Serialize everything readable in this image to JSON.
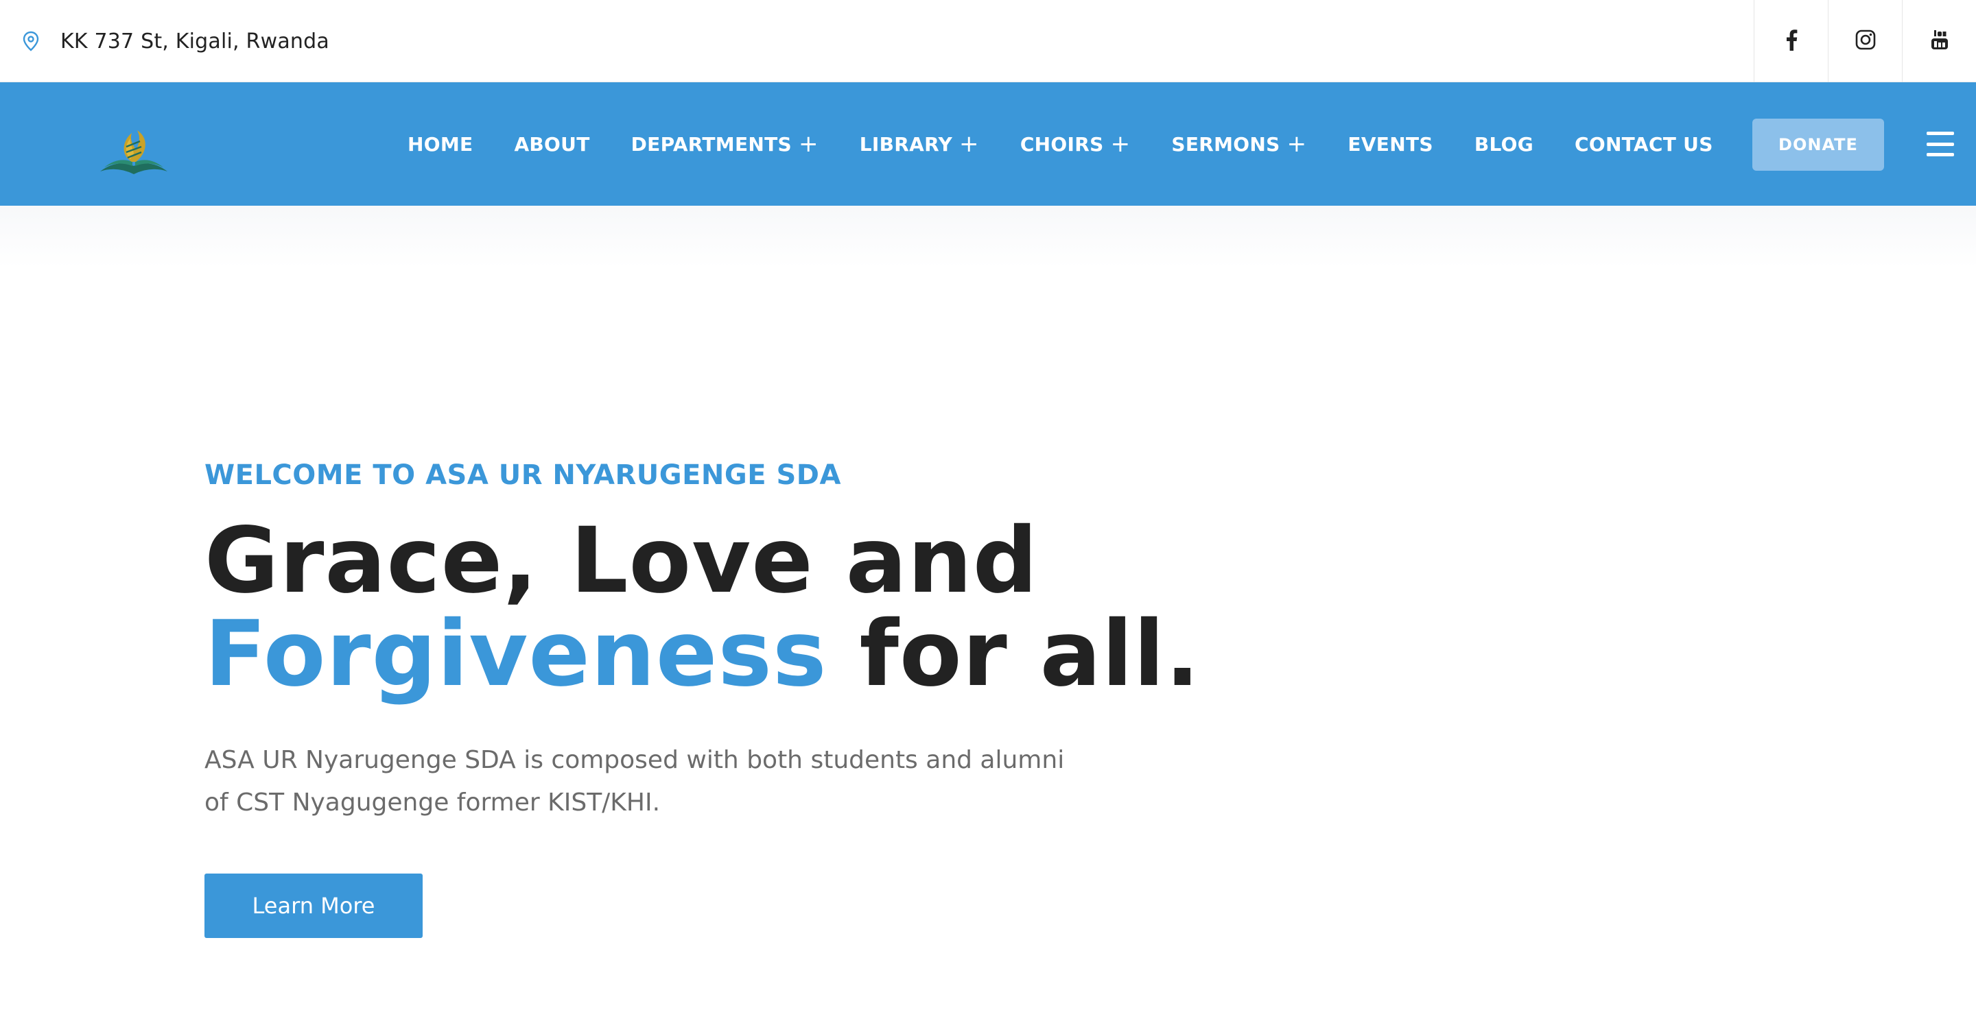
{
  "topbar": {
    "address": "KK 737 St, Kigali, Rwanda",
    "social": [
      "facebook-icon",
      "instagram-icon",
      "youtube-icon"
    ]
  },
  "nav": {
    "items": [
      {
        "label": "HOME",
        "has_submenu": false
      },
      {
        "label": "ABOUT",
        "has_submenu": false
      },
      {
        "label": "DEPARTMENTS",
        "has_submenu": true
      },
      {
        "label": "LIBRARY",
        "has_submenu": true
      },
      {
        "label": "CHOIRS",
        "has_submenu": true
      },
      {
        "label": "SERMONS",
        "has_submenu": true
      },
      {
        "label": "EVENTS",
        "has_submenu": false
      },
      {
        "label": "BLOG",
        "has_submenu": false
      },
      {
        "label": "CONTACT US",
        "has_submenu": false
      }
    ],
    "donate_label": "DONATE",
    "submenu_symbol": "+"
  },
  "hero": {
    "eyebrow": "WELCOME TO ASA UR NYARUGENGE SDA",
    "headline_line1": "Grace, Love and",
    "headline_accent": "Forgiveness",
    "headline_rest": "for all.",
    "lead": "ASA UR Nyarugenge SDA is composed with both students and alumni of CST Nyagugenge former KIST/KHI.",
    "cta_label": "Learn More"
  },
  "colors": {
    "primary": "#3b97d9",
    "donate_bg": "#8cc0ea",
    "heading": "#222222",
    "body_text": "#6b6b6b"
  }
}
